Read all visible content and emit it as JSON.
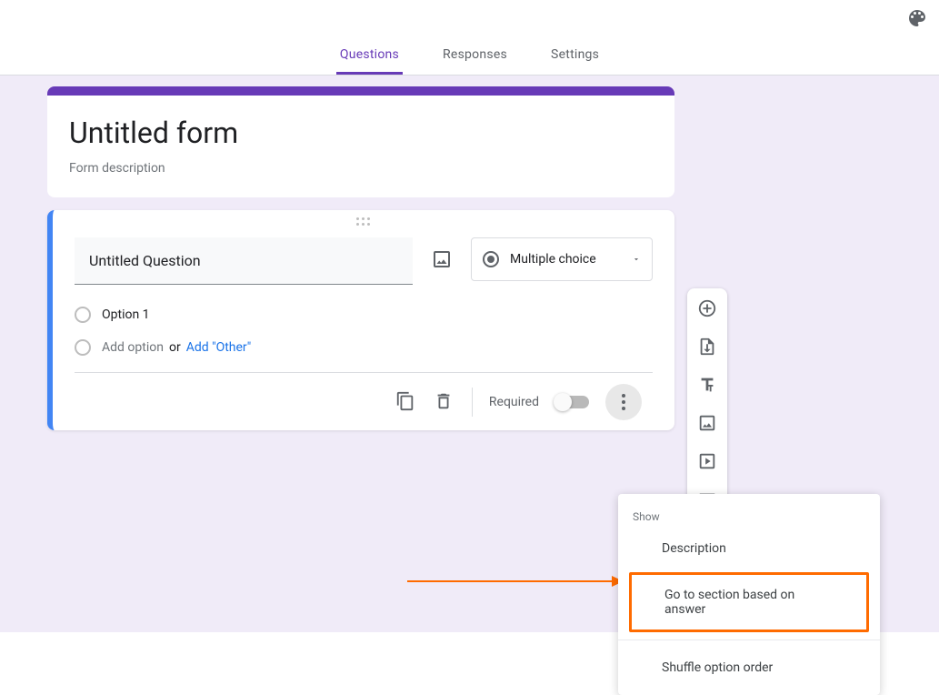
{
  "tabs": {
    "questions": "Questions",
    "responses": "Responses",
    "settings": "Settings"
  },
  "form": {
    "title": "Untitled form",
    "description": "Form description"
  },
  "question": {
    "text": "Untitled Question",
    "type_label": "Multiple choice",
    "option1": "Option 1",
    "add_option": "Add option",
    "or": "or",
    "add_other": "Add \"Other\"",
    "required_label": "Required"
  },
  "popup": {
    "section_label": "Show",
    "description": "Description",
    "goto": "Go to section based on answer",
    "shuffle": "Shuffle option order"
  }
}
